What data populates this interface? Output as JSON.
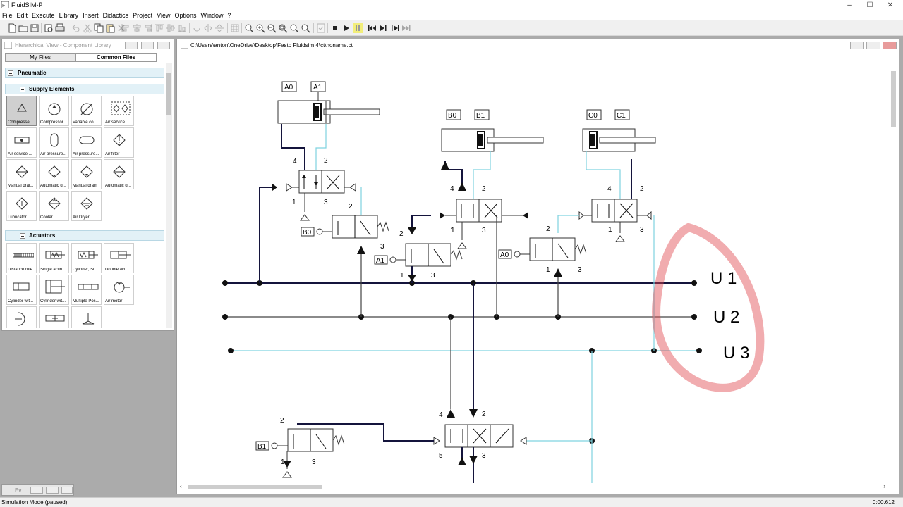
{
  "app": {
    "title": "FluidSIM-P"
  },
  "window_controls": {
    "minimize": "–",
    "maximize": "☐",
    "close": "✕"
  },
  "menu": [
    "File",
    "Edit",
    "Execute",
    "Library",
    "Insert",
    "Didactics",
    "Project",
    "View",
    "Options",
    "Window",
    "?"
  ],
  "toolbar": {
    "icons": [
      "new-icon",
      "open-icon",
      "save-icon",
      "print-preview-icon",
      "print-icon",
      "undo-icon",
      "cut-icon",
      "copy-icon",
      "paste-icon",
      "delete-icon",
      "align-left-icon",
      "align-center-icon",
      "align-right-icon",
      "align-top-icon",
      "align-middle-icon",
      "align-bottom-icon",
      "rotate-icon",
      "grid-icon",
      "zoom-icon",
      "zoom-in-icon",
      "zoom-out-icon",
      "zoom-fit-icon",
      "zoom-sheet-icon",
      "zoom-previous-icon",
      "check-icon",
      "stop-icon",
      "play-icon",
      "pause-icon",
      "rewind-icon",
      "step-icon",
      "step-continue-icon",
      "fast-forward-icon"
    ]
  },
  "library_panel": {
    "title": "Hierarchical View - Component Library",
    "tabs": [
      "My Files",
      "Common Files"
    ],
    "active_tab": "Common Files",
    "groups": [
      {
        "name": "Pneumatic",
        "level": 0
      },
      {
        "name": "Supply Elements",
        "level": 1,
        "items": [
          "Compresse...",
          "Compressor",
          "Variable co...",
          "Air service ...",
          "Air service ...",
          "Air pressure...",
          "Air pressure...",
          "Air filter",
          "Manual drai...",
          "Automatic d...",
          "Manual drain",
          "Automatic d...",
          "Lubricator",
          "Cooler",
          "Air Dryer"
        ]
      },
      {
        "name": "Actuators",
        "level": 1,
        "items": [
          "Distance rule",
          "Single actin...",
          "Cylinder, Si...",
          "Double acti...",
          "Cylinder wit...",
          "Cylinder wit...",
          "Multiple Pos...",
          "Air motor",
          "",
          "",
          ""
        ]
      }
    ]
  },
  "minimized_window": {
    "label": "Ev..."
  },
  "canvas_window": {
    "title": "C:\\Users\\anton\\OneDrive\\Desktop\\Festo Fluidsim 4\\ct\\noname.ct"
  },
  "diagram": {
    "cylinder_a": {
      "sensor_retracted": "A0",
      "sensor_extended": "A1"
    },
    "cylinder_b": {
      "sensor_retracted": "B0",
      "sensor_extended": "B1"
    },
    "cylinder_c": {
      "sensor_retracted": "C0",
      "sensor_extended": "C1"
    },
    "port_labels": {
      "p4": "4",
      "p2": "2",
      "p1": "1",
      "p3": "3",
      "p5": "5"
    },
    "sensor_valve_labels": {
      "b0": "B0",
      "a1": "A1",
      "a0": "A0",
      "b1": "B1"
    },
    "rails": {
      "u1": "U 1",
      "u2": "U 2",
      "u3": "U 3"
    },
    "colors": {
      "pressure_line": "#14143c",
      "signal_line": "#2b2b2b",
      "exhaust_line": "#7fd3e0",
      "annotation": "#e0484d"
    }
  },
  "status": {
    "mode": "Simulation Mode (paused)",
    "time": "0:00.612"
  }
}
